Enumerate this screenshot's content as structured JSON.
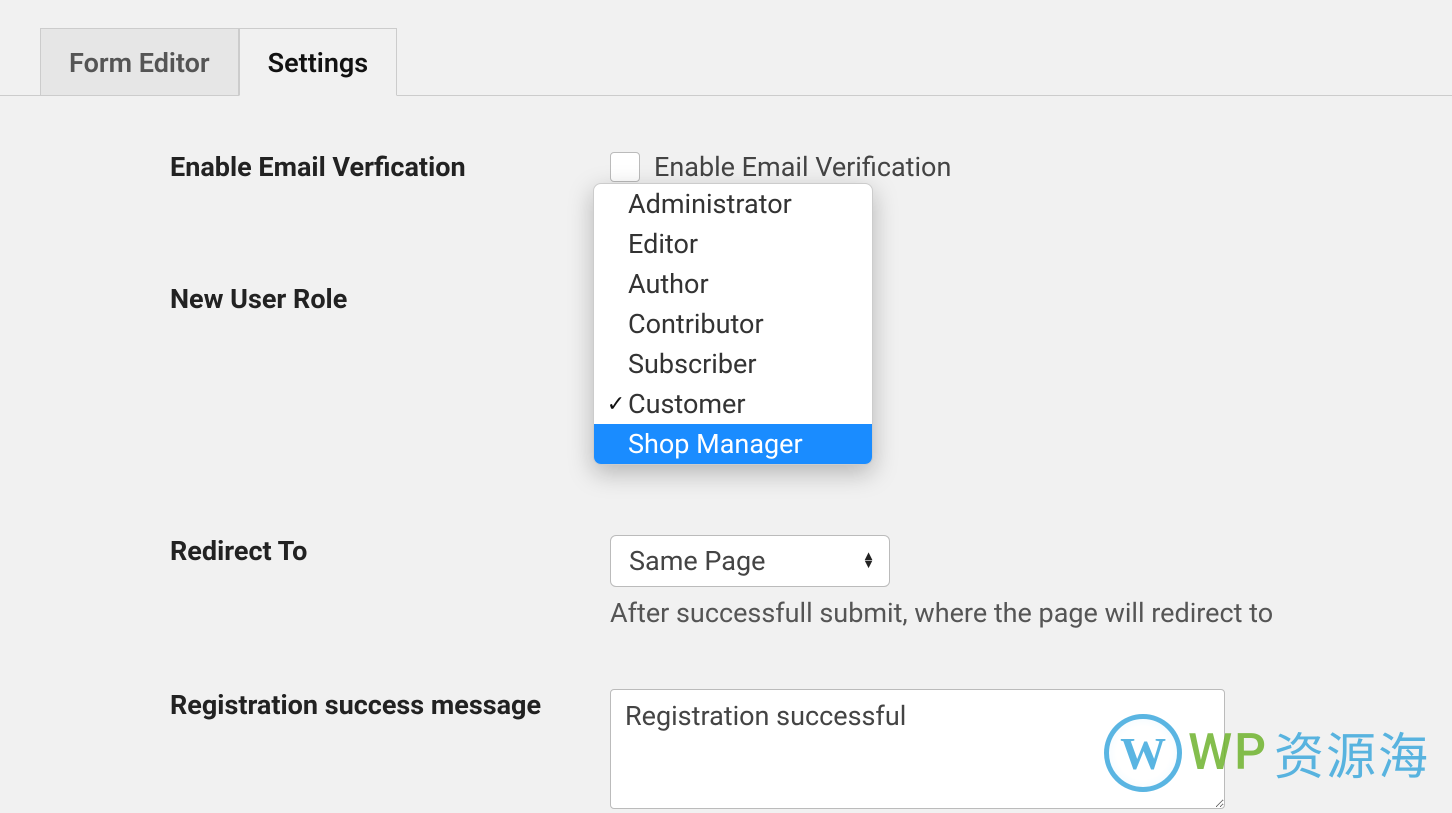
{
  "tabs": {
    "form_editor": "Form Editor",
    "settings": "Settings"
  },
  "form": {
    "enable_email_verification": {
      "label": "Enable Email Verfication",
      "checkbox_label": "Enable Email Verification"
    },
    "new_user_role": {
      "label": "New User Role",
      "options": [
        "Administrator",
        "Editor",
        "Author",
        "Contributor",
        "Subscriber",
        "Customer",
        "Shop Manager"
      ],
      "selected": "Customer",
      "highlighted": "Shop Manager"
    },
    "redirect_to": {
      "label": "Redirect To",
      "selected": "Same Page",
      "helper": "After successfull submit, where the page will redirect to"
    },
    "registration_success": {
      "label": "Registration success message",
      "value": "Registration successful"
    }
  },
  "watermark": {
    "logo_letter": "W",
    "text_green": "WP",
    "text_blue": "资源海"
  }
}
